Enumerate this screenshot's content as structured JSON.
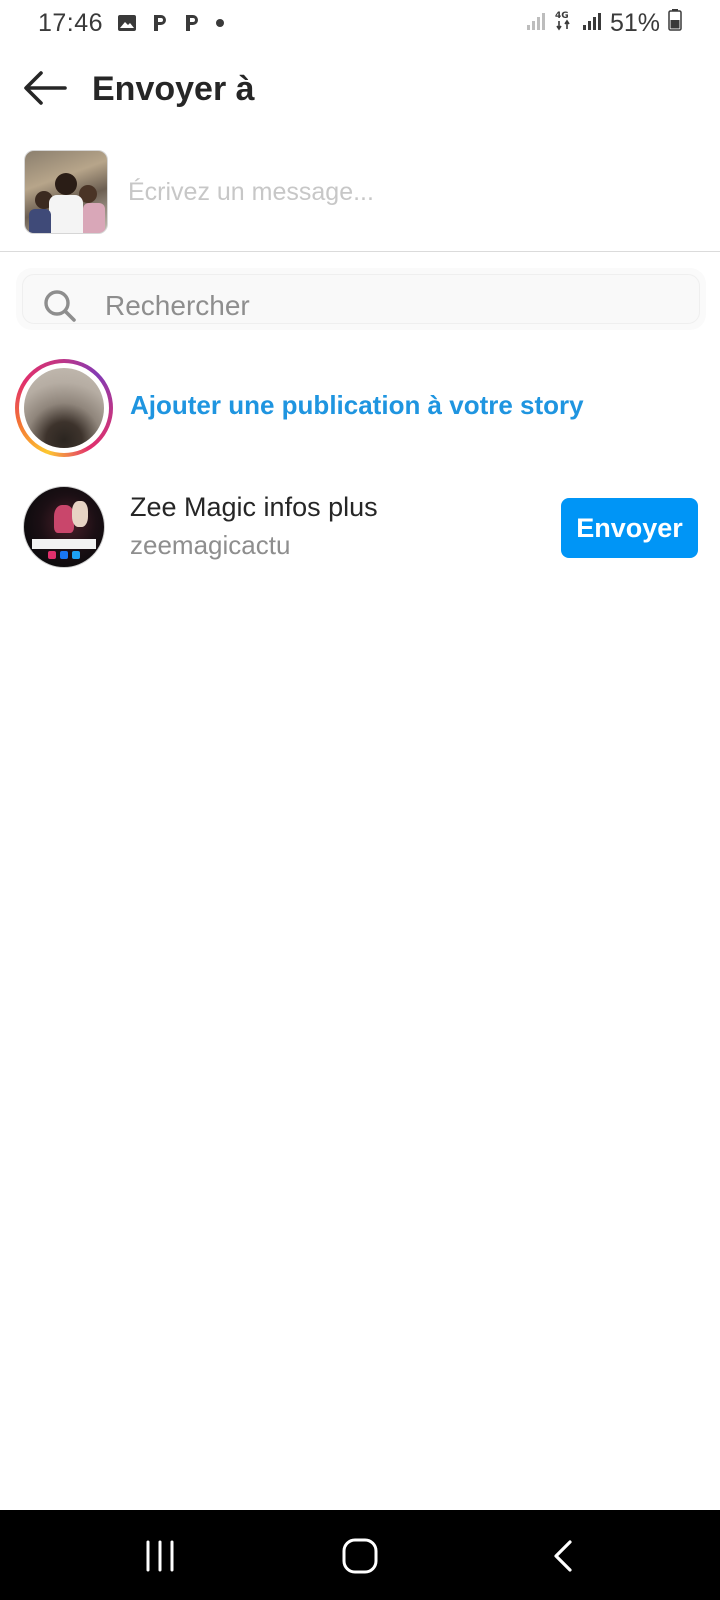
{
  "status_bar": {
    "time": "17:46",
    "notification_icons": [
      "gallery-icon",
      "parking-icon",
      "parking-icon",
      "dot-icon"
    ],
    "network_label": "4G",
    "battery": "51%"
  },
  "header": {
    "back_icon": "arrow-left-icon",
    "title": "Envoyer à"
  },
  "compose": {
    "message_placeholder": "Écrivez un message...",
    "message_value": ""
  },
  "search": {
    "icon": "search-icon",
    "placeholder": "Rechercher",
    "value": ""
  },
  "story": {
    "label": "Ajouter une publication à votre story",
    "label_color": "#1f95e0"
  },
  "contacts": [
    {
      "name": "Zee Magic infos plus",
      "username": "zeemagicactu",
      "button_label": "Envoyer"
    }
  ],
  "colors": {
    "accent": "#0095f6",
    "secondary_text": "#8e8e8e",
    "primary_text": "#262626"
  },
  "nav_bar": {
    "buttons": [
      "recents-icon",
      "home-icon",
      "back-chevron-icon"
    ]
  }
}
